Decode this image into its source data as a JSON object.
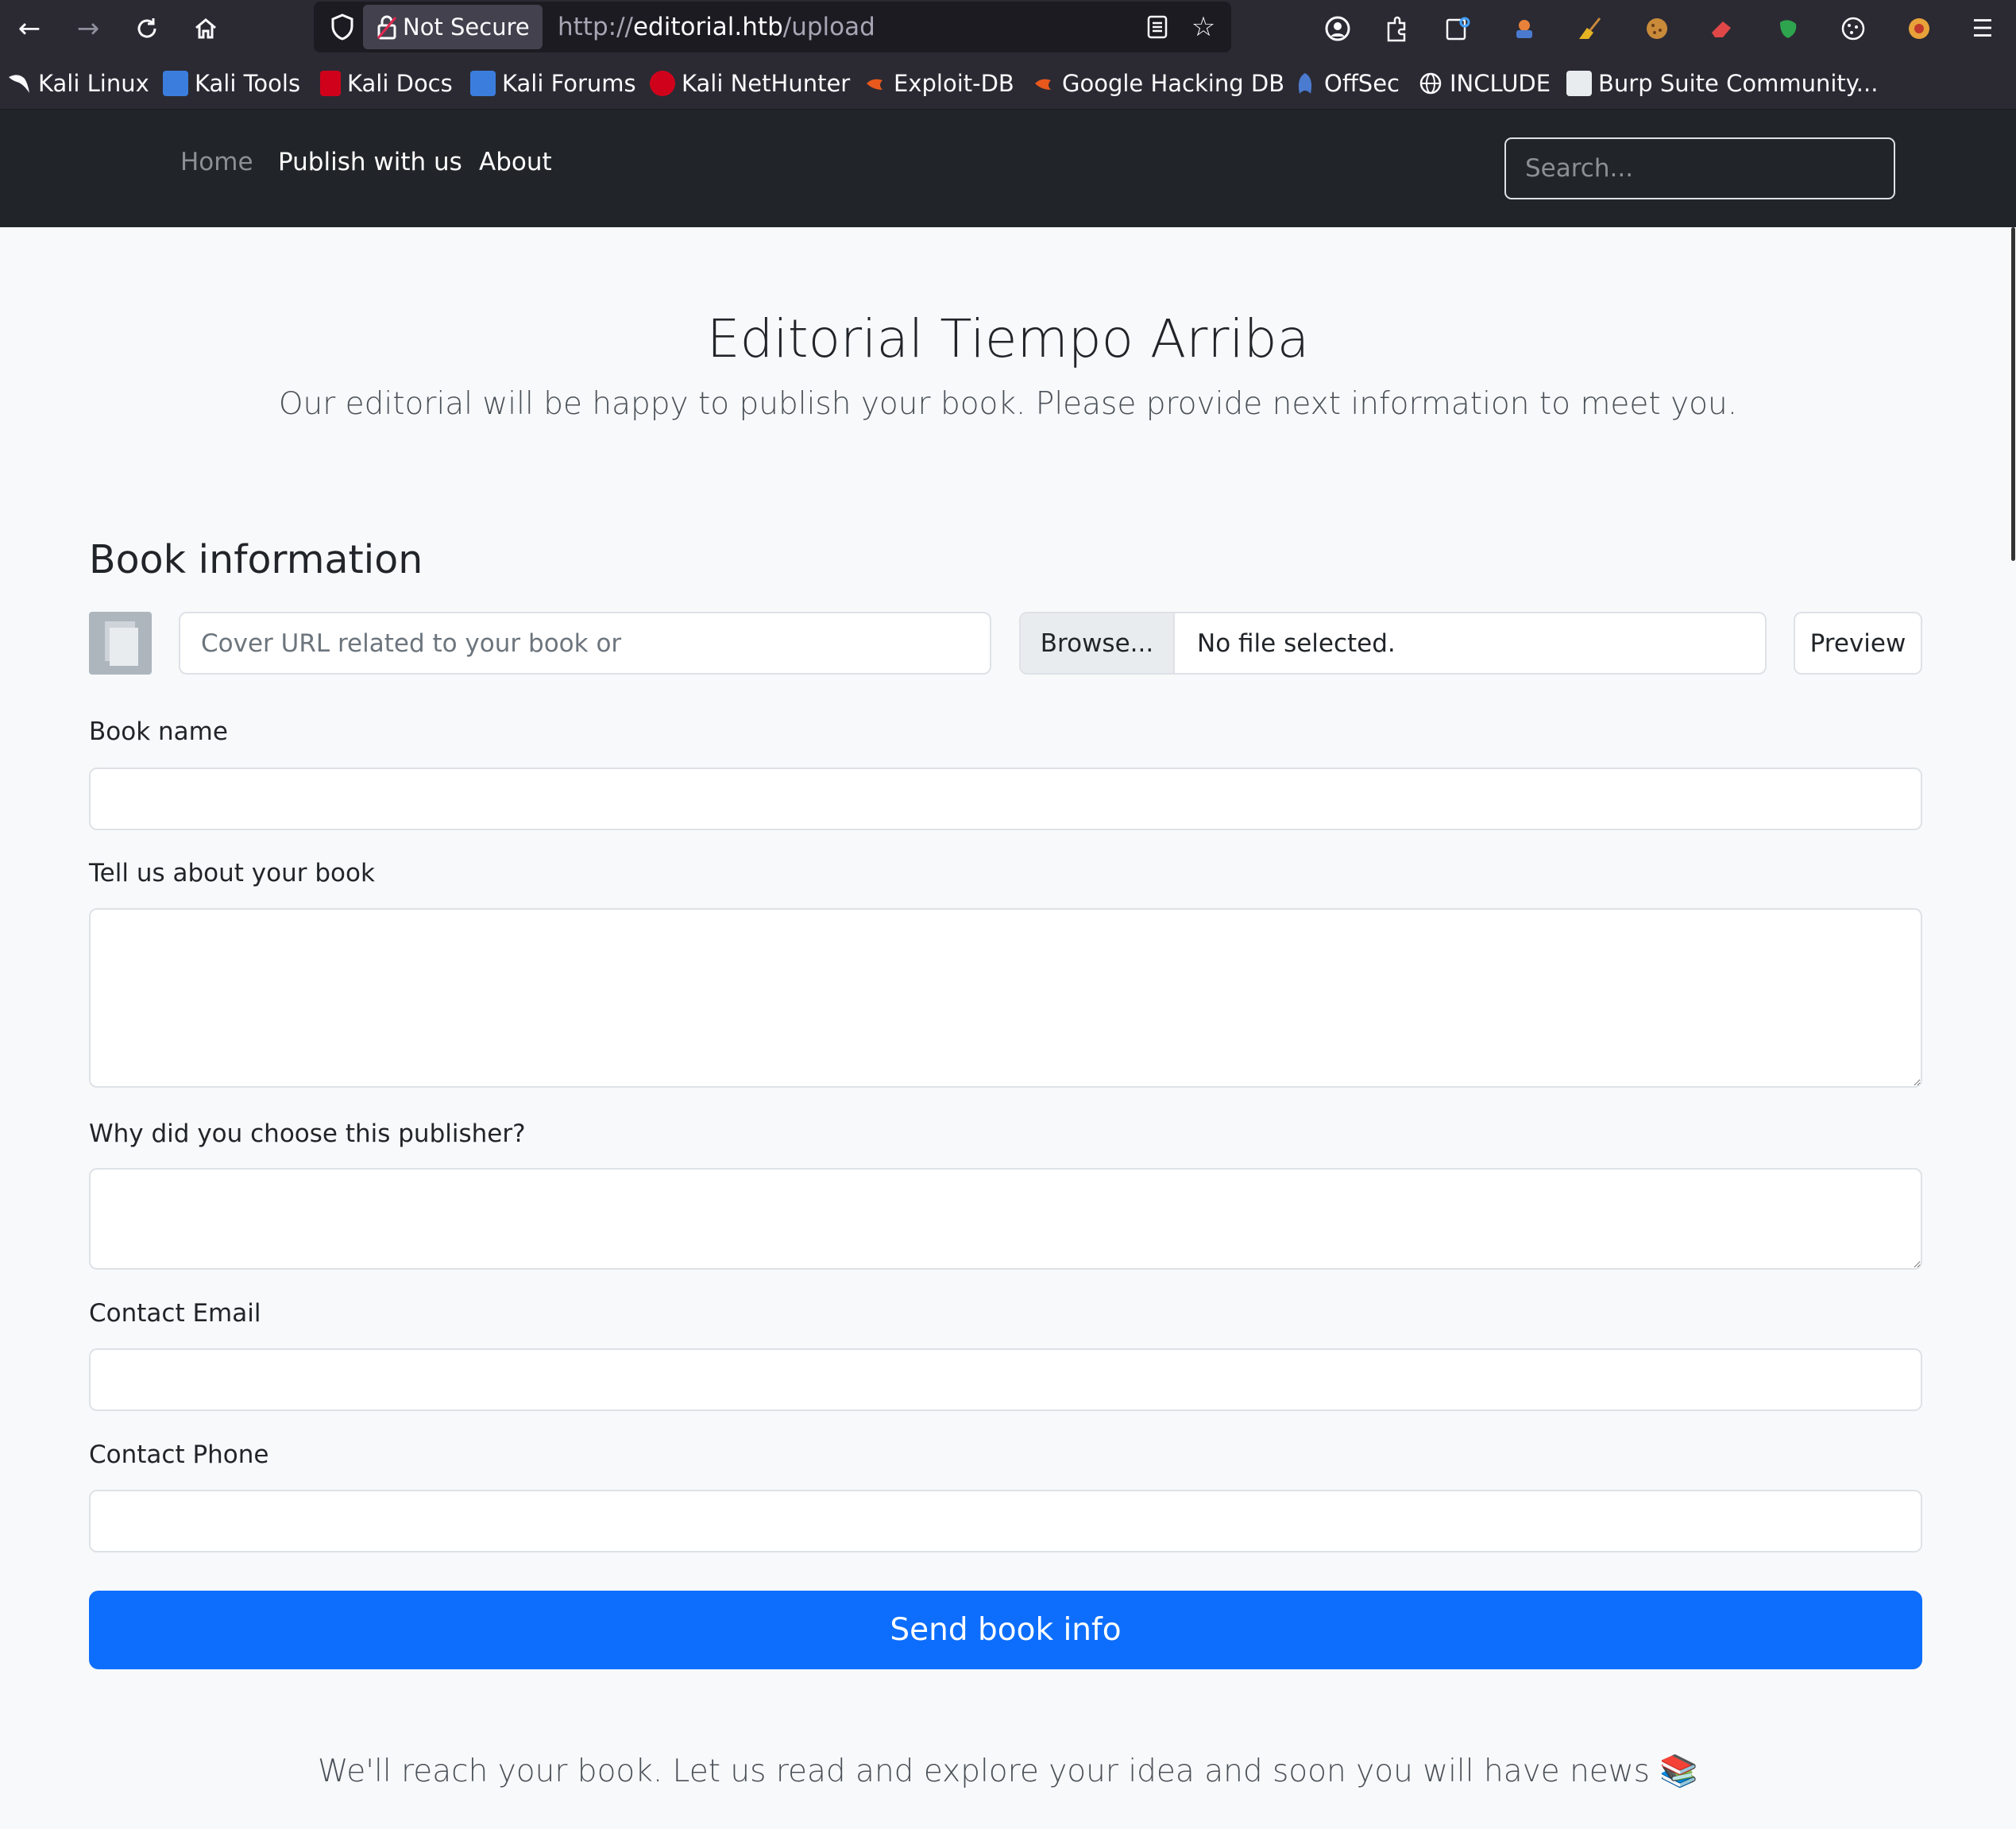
{
  "browser": {
    "not_secure_label": "Not Secure",
    "url_scheme": "http://",
    "url_host": "editorial.htb",
    "url_path": "/upload",
    "bookmarks": [
      {
        "label": "Kali Linux",
        "icon": "kali-dragon-icon",
        "color": "#ffffff"
      },
      {
        "label": "Kali Tools",
        "icon": "kali-tools-icon",
        "color": "#3b7ddd"
      },
      {
        "label": "Kali Docs",
        "icon": "kali-docs-icon",
        "color": "#d0021b"
      },
      {
        "label": "Kali Forums",
        "icon": "kali-forums-icon",
        "color": "#3b7ddd"
      },
      {
        "label": "Kali NetHunter",
        "icon": "nethunter-icon",
        "color": "#d0021b"
      },
      {
        "label": "Exploit-DB",
        "icon": "exploit-db-icon",
        "color": "#e8581c"
      },
      {
        "label": "Google Hacking DB",
        "icon": "ghdb-icon",
        "color": "#e8581c"
      },
      {
        "label": "OffSec",
        "icon": "offsec-icon",
        "color": "#4a7bd0"
      },
      {
        "label": "INCLUDE",
        "icon": "globe-icon",
        "color": "#ffffff"
      },
      {
        "label": "Burp Suite Community...",
        "icon": "burp-icon",
        "color": "#ffffff"
      }
    ]
  },
  "nav": {
    "home": "Home",
    "publish": "Publish with us",
    "about": "About",
    "search_placeholder": "Search..."
  },
  "hero": {
    "title": "Editorial Tiempo Arriba",
    "subtitle": "Our editorial will be happy to publish your book. Please provide next information to meet you."
  },
  "form": {
    "section_title": "Book information",
    "cover_url_placeholder": "Cover URL related to your book or",
    "browse_label": "Browse...",
    "file_status": "No file selected.",
    "preview_label": "Preview",
    "book_name_label": "Book name",
    "about_label": "Tell us about your book",
    "why_label": "Why did you choose this publisher?",
    "email_label": "Contact Email",
    "phone_label": "Contact Phone",
    "submit_label": "Send book info"
  },
  "footer": {
    "note": "We'll reach your book. Let us read and explore your idea and soon you will have news 📚"
  },
  "colors": {
    "primary": "#0d6efd",
    "navbar": "#212529",
    "page_bg": "#f8f9fa"
  }
}
